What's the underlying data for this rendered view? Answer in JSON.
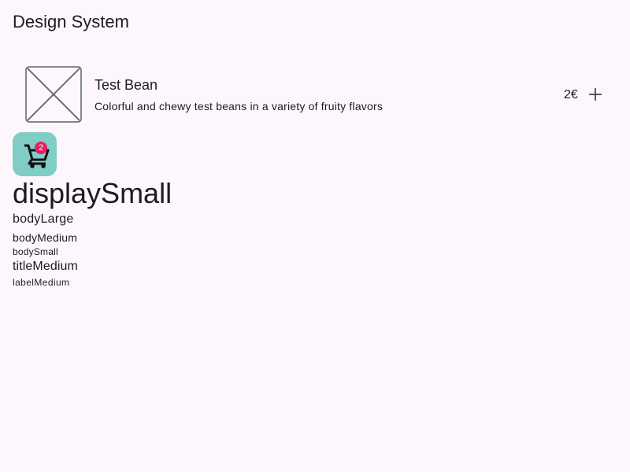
{
  "header": {
    "title": "Design System"
  },
  "product": {
    "name": "Test Bean",
    "description": "Colorful and chewy test beans in a variety of fruity flavors",
    "price": "2€",
    "thumbnail_icon": "image-placeholder-icon",
    "add_icon": "plus-icon"
  },
  "cart": {
    "icon": "shopping-cart-icon",
    "badge_count": "2"
  },
  "typography": {
    "display_small": "displaySmall",
    "body_large": "bodyLarge",
    "body_medium": "bodyMedium",
    "body_small": "bodySmall",
    "title_medium": "titleMedium",
    "label_medium": "labelMedium"
  },
  "colors": {
    "background": "#fdf7fd",
    "cart_button": "#80cdc6",
    "badge": "#e91e63",
    "text": "#1d1b20",
    "placeholder_stroke": "#5c6268"
  }
}
